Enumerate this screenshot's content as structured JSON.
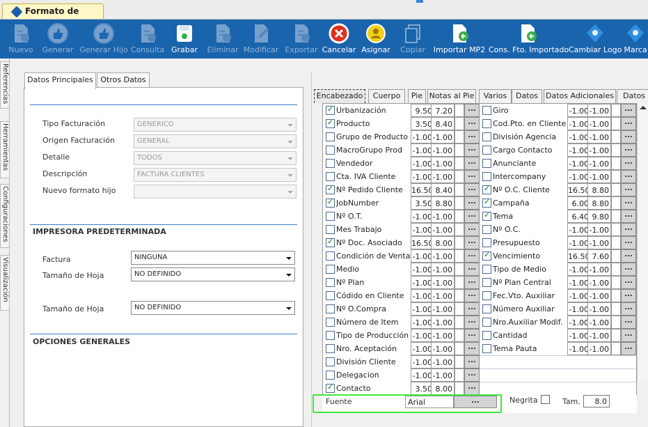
{
  "window": {
    "tab_title": "Formato de Factura"
  },
  "toolbar": [
    {
      "label": "Nuevo",
      "icon": "new-doc-icon",
      "enabled": false
    },
    {
      "label": "Generar",
      "icon": "thumb-up-icon",
      "enabled": false
    },
    {
      "label": "Generar Hijo",
      "icon": "thumb-up-icon",
      "enabled": false
    },
    {
      "label": "Consulta",
      "icon": "query-doc-icon",
      "enabled": false
    },
    {
      "label": "Grabar",
      "icon": "save-icon",
      "enabled": true
    },
    {
      "label": "Eliminar",
      "icon": "delete-doc-icon",
      "enabled": false
    },
    {
      "label": "Modificar",
      "icon": "edit-doc-icon",
      "enabled": false
    },
    {
      "label": "Exportar",
      "icon": "export-doc-icon",
      "enabled": false
    },
    {
      "label": "Cancelar",
      "icon": "cancel-icon",
      "enabled": true
    },
    {
      "label": "Asignar",
      "icon": "assign-icon",
      "enabled": true
    },
    {
      "label": "Copiar",
      "icon": "copy-icon",
      "enabled": false
    },
    {
      "label": "Importar MP2",
      "icon": "import-doc-icon",
      "enabled": true
    },
    {
      "label": "Cons. Fto. Importado",
      "icon": "import-doc-icon",
      "enabled": true
    },
    {
      "label": "Cambiar Logo",
      "icon": "logo-icon",
      "enabled": true
    },
    {
      "label": "Marca",
      "icon": "logo-icon",
      "enabled": true
    }
  ],
  "side_tabs": [
    "Referencias",
    "Herramientas",
    "Configuraciones",
    "Visualización"
  ],
  "left_tabs": [
    "Datos Principales",
    "Otros Datos"
  ],
  "main": {
    "fields": [
      {
        "label": "Tipo Facturación",
        "value": "GENERICO"
      },
      {
        "label": "Origen Facturación",
        "value": "GENERAL"
      },
      {
        "label": "Detalle",
        "value": "TODOS"
      },
      {
        "label": "Descripción",
        "value": "FACTURA CLIENTES"
      },
      {
        "label": "Nuevo formato hijo",
        "value": ""
      }
    ],
    "printer_section": "IMPRESORA PREDETERMINADA",
    "printer_fields": [
      {
        "label": "Factura",
        "value": "NINGUNA"
      },
      {
        "label": "Tamaño de Hoja",
        "value": "NO DEFINIDO"
      },
      {
        "label": "Tamaño de Hoja",
        "value": "NO DEFINIDO"
      }
    ],
    "options_section": "OPCIONES GENERALES"
  },
  "right_tabs": [
    "Encabezado",
    "Cuerpo",
    "Pie",
    "Notas al Pie",
    "Varios",
    "Datos",
    "Datos Adicionales",
    "Datos"
  ],
  "left_rows": [
    {
      "checked": true,
      "name": "Urbanización",
      "a": "9.50",
      "b": "7.20"
    },
    {
      "checked": true,
      "name": "Producto",
      "a": "3.50",
      "b": "8.40"
    },
    {
      "checked": false,
      "name": "Grupo de Producto",
      "a": "-1.00",
      "b": "-1.00"
    },
    {
      "checked": false,
      "name": "MacroGrupo Prod",
      "a": "-1.00",
      "b": "-1.00"
    },
    {
      "checked": false,
      "name": "Vendedor",
      "a": "-1.00",
      "b": "-1.00"
    },
    {
      "checked": false,
      "name": "Cta. IVA Cliente",
      "a": "-1.00",
      "b": "-1.00"
    },
    {
      "checked": true,
      "name": "Nº Pedido Cliente",
      "a": "16.50",
      "b": "8.40"
    },
    {
      "checked": true,
      "name": "JobNumber",
      "a": "3.50",
      "b": "8.80"
    },
    {
      "checked": false,
      "name": "Nº O.T.",
      "a": "-1.00",
      "b": "-1.00"
    },
    {
      "checked": false,
      "name": "Mes Trabajo",
      "a": "-1.00",
      "b": "-1.00"
    },
    {
      "checked": true,
      "name": "Nº Doc. Asociado",
      "a": "16.50",
      "b": "8.00"
    },
    {
      "checked": false,
      "name": "Condición de Venta",
      "a": "-1.00",
      "b": "-1.00"
    },
    {
      "checked": false,
      "name": "Medio",
      "a": "-1.00",
      "b": "-1.00"
    },
    {
      "checked": false,
      "name": "Nº Plan",
      "a": "-1.00",
      "b": "-1.00"
    },
    {
      "checked": false,
      "name": "Códido en Cliente",
      "a": "-1.00",
      "b": "-1.00"
    },
    {
      "checked": false,
      "name": "Nº O.Compra",
      "a": "-1.00",
      "b": "-1.00"
    },
    {
      "checked": false,
      "name": "Número de Item",
      "a": "-1.00",
      "b": "-1.00"
    },
    {
      "checked": false,
      "name": "Tipo de Producción",
      "a": "-1.00",
      "b": "-1.00"
    },
    {
      "checked": false,
      "name": "Nro. Aceptación",
      "a": "-1.00",
      "b": "-1.00"
    },
    {
      "checked": false,
      "name": "División Cliente",
      "a": "-1.00",
      "b": "-1.00"
    },
    {
      "checked": false,
      "name": "Delegacion",
      "a": "-1.00",
      "b": "-1.00"
    },
    {
      "checked": true,
      "name": "Contacto",
      "a": "3.50",
      "b": "8.00"
    }
  ],
  "right_rows": [
    {
      "checked": false,
      "name": "Giro",
      "a": "-1.00",
      "b": "-1.00"
    },
    {
      "checked": false,
      "name": "Cod.Pto. en Cliente",
      "a": "-1.00",
      "b": "-1.00"
    },
    {
      "checked": false,
      "name": "División Agencia",
      "a": "-1.00",
      "b": "-1.00"
    },
    {
      "checked": false,
      "name": "Cargo Contacto",
      "a": "-1.00",
      "b": "-1.00"
    },
    {
      "checked": false,
      "name": "Anunciante",
      "a": "-1.00",
      "b": "-1.00"
    },
    {
      "checked": false,
      "name": "Intercompany",
      "a": "-1.00",
      "b": "-1.00"
    },
    {
      "checked": true,
      "name": "Nº O.C. Cliente",
      "a": "16.50",
      "b": "8.80"
    },
    {
      "checked": true,
      "name": "Campaña",
      "a": "6.00",
      "b": "8.80"
    },
    {
      "checked": true,
      "name": "Tema",
      "a": "6.40",
      "b": "9.80"
    },
    {
      "checked": false,
      "name": "Nº O.C.",
      "a": "-1.00",
      "b": "-1.00"
    },
    {
      "checked": false,
      "name": "Presupuesto",
      "a": "-1.00",
      "b": "-1.00"
    },
    {
      "checked": true,
      "name": "Vencimiento",
      "a": "16.50",
      "b": "7.60"
    },
    {
      "checked": false,
      "name": "Tipo de Medio",
      "a": "-1.00",
      "b": "-1.00"
    },
    {
      "checked": false,
      "name": "Nº Plan Central",
      "a": "-1.00",
      "b": "-1.00"
    },
    {
      "checked": false,
      "name": "Fec.Vto. Auxiliar",
      "a": "-1.00",
      "b": "-1.00"
    },
    {
      "checked": false,
      "name": "Número Auxiliar",
      "a": "-1.00",
      "b": "-1.00"
    },
    {
      "checked": false,
      "name": "Nro.Auxiliar Modif.",
      "a": "-1.00",
      "b": "-1.00"
    },
    {
      "checked": false,
      "name": "Cantidad",
      "a": "-1.00",
      "b": "-1.00"
    },
    {
      "checked": false,
      "name": "Tema Pauta",
      "a": "-1.00",
      "b": "-1.00"
    }
  ],
  "ellipsis": "...",
  "bottom": {
    "font_label": "Fuente",
    "font_value": "Arial",
    "ellipsis": "...",
    "bold_label": "Negrita",
    "size_label": "Tam.",
    "size_value": "8.0"
  },
  "colors": {
    "toolbar": "#1a63ad",
    "highlight": "#3ee83e",
    "check": "#0a7a1a"
  }
}
